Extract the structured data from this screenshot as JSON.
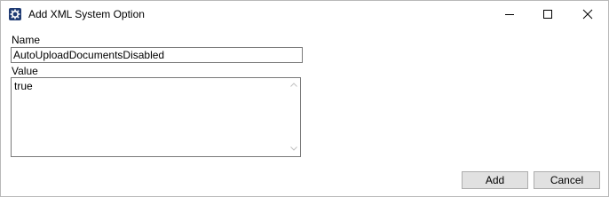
{
  "window": {
    "title": "Add XML System Option",
    "app_icon": "gear-icon",
    "controls": {
      "minimize_icon": "minimize-icon",
      "maximize_icon": "maximize-icon",
      "close_icon": "close-icon"
    }
  },
  "form": {
    "name_label": "Name",
    "name_value": "AutoUploadDocumentsDisabled",
    "value_label": "Value",
    "value_value": "true"
  },
  "buttons": {
    "add_label": "Add",
    "cancel_label": "Cancel"
  },
  "colors": {
    "app_icon_bg": "#1f3b73",
    "button_bg": "#e1e1e1",
    "button_border": "#adadad",
    "field_border": "#7a7a7a"
  }
}
